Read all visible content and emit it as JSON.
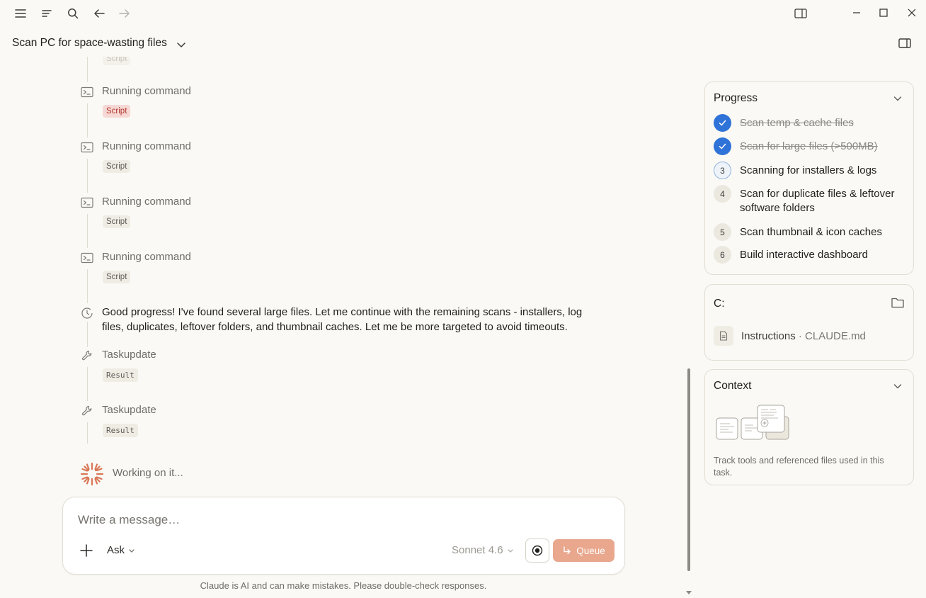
{
  "titlebar": {
    "icons": [
      "menu-icon",
      "sidebar-list-icon",
      "search-icon",
      "back-arrow-icon",
      "forward-arrow-icon",
      "split-view-icon"
    ],
    "window_controls": [
      "minimize-icon",
      "maximize-icon",
      "close-icon"
    ]
  },
  "header": {
    "title": "Scan PC for space-wasting files"
  },
  "timeline": {
    "partial_chip": "Script",
    "steps": [
      {
        "icon": "terminal-icon",
        "title": "Running command",
        "chip": "Script",
        "chip_style": "error"
      },
      {
        "icon": "terminal-icon",
        "title": "Running command",
        "chip": "Script"
      },
      {
        "icon": "terminal-icon",
        "title": "Running command",
        "chip": "Script"
      },
      {
        "icon": "terminal-icon",
        "title": "Running command",
        "chip": "Script"
      }
    ],
    "message": "Good progress! I've found several large files. Let me continue with the remaining scans - installers, log files, duplicates, leftover folders, and thumbnail caches. Let me be more targeted to avoid timeouts.",
    "tool_steps": [
      {
        "icon": "wrench-icon",
        "title": "Taskupdate",
        "chip": "Result"
      },
      {
        "icon": "wrench-icon",
        "title": "Taskupdate",
        "chip": "Result"
      }
    ],
    "working": "Working on it..."
  },
  "composer": {
    "placeholder": "Write a message…",
    "mode": "Ask",
    "model": "Sonnet 4.6",
    "queue_label": "Queue"
  },
  "disclaimer": "Claude is AI and can make mistakes. Please double-check responses.",
  "progress": {
    "title": "Progress",
    "items": [
      {
        "status": "done",
        "badge": "",
        "label": "Scan temp & cache files"
      },
      {
        "status": "done",
        "badge": "",
        "label": "Scan for large files (>500MB)"
      },
      {
        "status": "active",
        "badge": "3",
        "label": "Scanning for installers & logs"
      },
      {
        "status": "todo",
        "badge": "4",
        "label": "Scan for duplicate files & leftover software folders"
      },
      {
        "status": "todo",
        "badge": "5",
        "label": "Scan thumbnail & icon caches"
      },
      {
        "status": "todo",
        "badge": "6",
        "label": "Build interactive dashboard"
      }
    ]
  },
  "drive": {
    "title": "C:",
    "file_label": "Instructions",
    "file_separator": " · ",
    "file_name": "CLAUDE.md"
  },
  "context": {
    "title": "Context",
    "description": "Track tools and referenced files used in this task."
  },
  "colors": {
    "background": "#faf9f5",
    "accent_blue": "#2f73d8",
    "queue_button": "#e9a78d",
    "spinner": "#d97757",
    "error_chip_bg": "#f6d8d4",
    "error_chip_text": "#b4362c"
  }
}
